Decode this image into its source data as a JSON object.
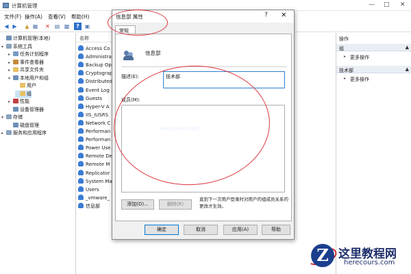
{
  "window": {
    "title": "计算机管理",
    "controls": {
      "minimize": "—",
      "maximize": "□",
      "close": "✕"
    }
  },
  "menu": [
    "文件(F)",
    "操作(A)",
    "查看(V)",
    "帮助(H)"
  ],
  "toolbar_icons": [
    "back-arrow-icon",
    "forward-arrow-icon",
    "up-folder-icon",
    "show-tree-icon",
    "delete-icon",
    "properties-icon",
    "export-icon",
    "help-icon",
    "view-icon"
  ],
  "tree": [
    {
      "label": "计算机管理(本地)",
      "level": 0,
      "arrow": "",
      "icon_color": "#6c8fb8"
    },
    {
      "label": "系统工具",
      "level": 0,
      "arrow": "▾",
      "icon_color": "#8aa2bf"
    },
    {
      "label": "任务计划程序",
      "level": 1,
      "arrow": "▸",
      "icon_color": "#7a9cc4"
    },
    {
      "label": "事件查看器",
      "level": 1,
      "arrow": "▸",
      "icon_color": "#c58a3a"
    },
    {
      "label": "共享文件夹",
      "level": 1,
      "arrow": "▸",
      "icon_color": "#e8c066"
    },
    {
      "label": "本地用户和组",
      "level": 1,
      "arrow": "▾",
      "icon_color": "#6c8fb8"
    },
    {
      "label": "用户",
      "level": 2,
      "arrow": "",
      "icon_color": "#e8c066"
    },
    {
      "label": "组",
      "level": 2,
      "arrow": "",
      "icon_color": "#e8c066",
      "selected": true
    },
    {
      "label": "性能",
      "level": 1,
      "arrow": "▸",
      "icon_color": "#c04040"
    },
    {
      "label": "设备管理器",
      "level": 1,
      "arrow": "",
      "icon_color": "#6c8fb8"
    },
    {
      "label": "存储",
      "level": 0,
      "arrow": "▾",
      "icon_color": "#8aa2bf"
    },
    {
      "label": "磁盘管理",
      "level": 1,
      "arrow": "",
      "icon_color": "#6c8fb8"
    },
    {
      "label": "服务和应用程序",
      "level": 0,
      "arrow": "▸",
      "icon_color": "#8aa2bf"
    }
  ],
  "list": {
    "header": "名称",
    "items": [
      "Access Co",
      "Administra",
      "Backup Op",
      "Cryptograp",
      "Distributed",
      "Event Log",
      "Guests",
      "Hyper-V A",
      "IIS_IUSRS",
      "Network C",
      "Performan",
      "Performan",
      "Power Use",
      "Remote De",
      "Remote M",
      "Replicator",
      "System Ma",
      "Users",
      "_vmware_",
      "信息部"
    ]
  },
  "actions": {
    "section1": "操作",
    "group": "组",
    "more1": "更多操作",
    "group2": "技术部",
    "more2": "更多操作"
  },
  "dialog": {
    "title": "信息部 属性",
    "help": "?",
    "close": "✕",
    "tab": "常规",
    "group_name": "信息部",
    "desc_label": "描述(E):",
    "desc_value": "技术部",
    "members_label": "成员(M):",
    "watermark": "www.pHome.NET",
    "add": "添加(D)...",
    "remove": "删除(R)",
    "note": "直到下一次用户登录时对用户的组成员关系的更改才生效。",
    "ok": "确定",
    "cancel": "取消",
    "apply": "应用(A)",
    "help_btn": "帮助"
  },
  "colors": {
    "annotation": "#d9363e",
    "selection": "#cce4f7",
    "focus": "#2e7fd1"
  },
  "logo": {
    "mark": "Z",
    "name": "这里教程网",
    "domain": "herecours.com"
  }
}
